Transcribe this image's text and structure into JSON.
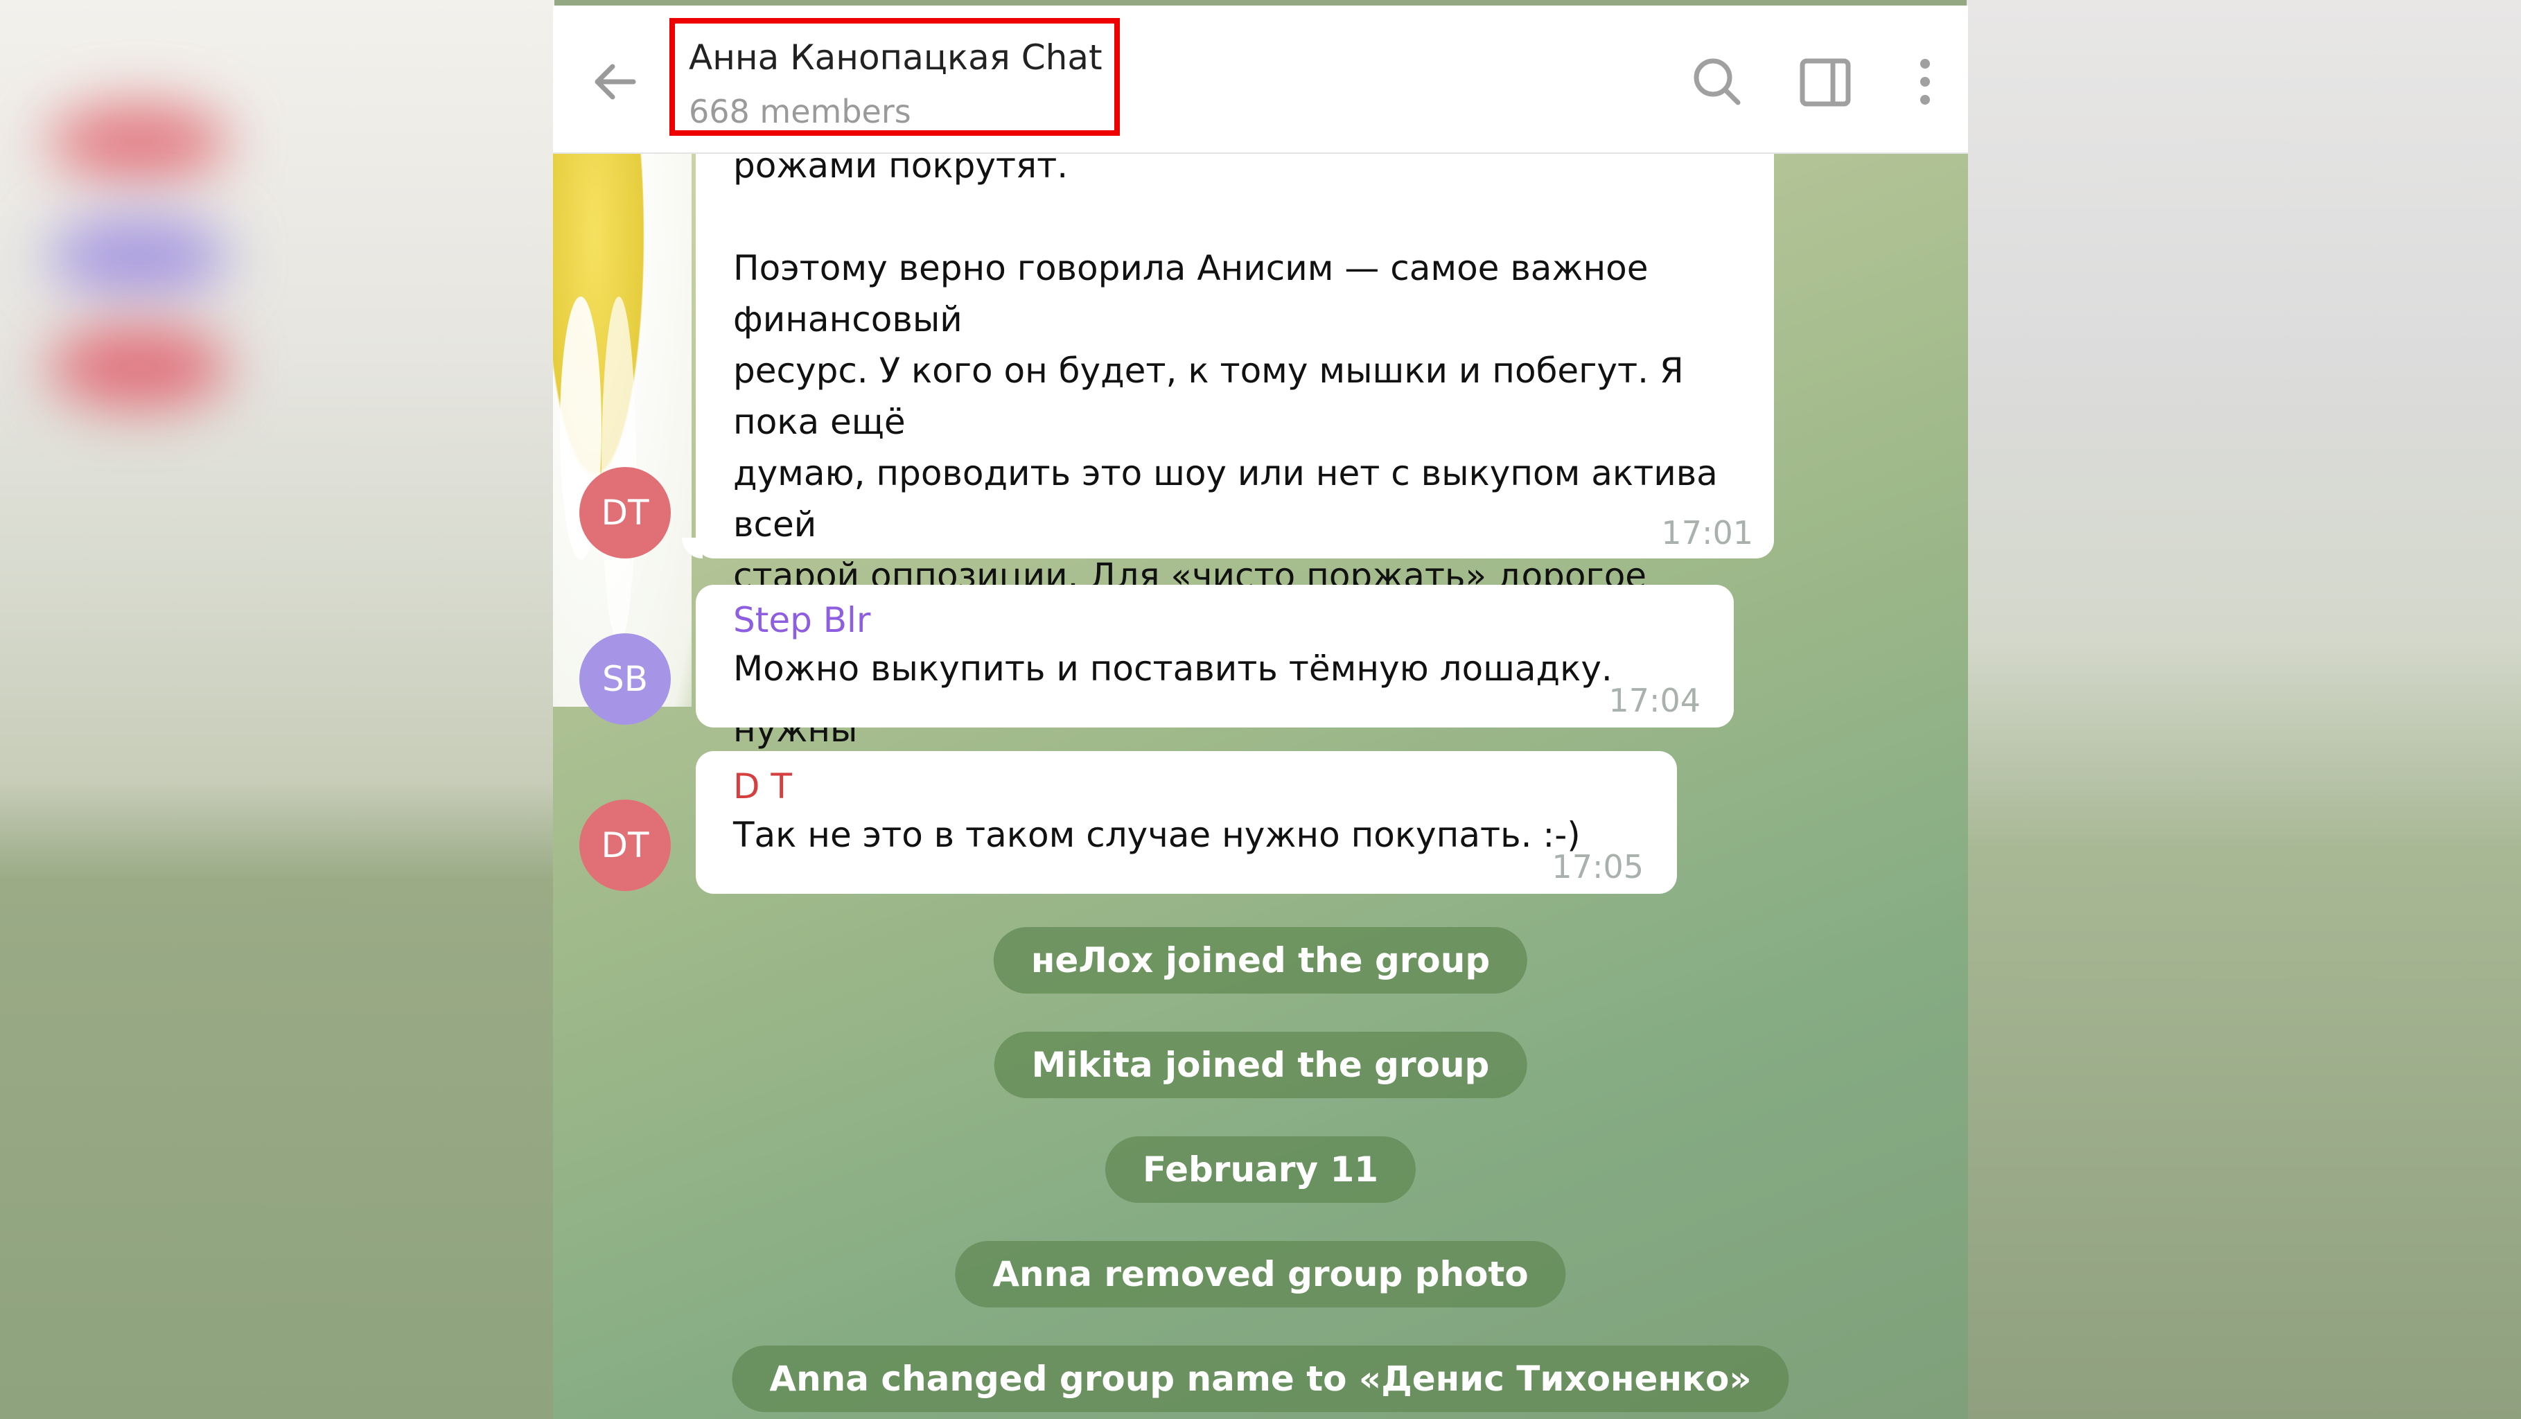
{
  "chat": {
    "title": "Анна Канопацкая Chat",
    "members": "668 members",
    "highlight_color": "#ee0000"
  },
  "header_icons": [
    "back-arrow-icon",
    "search-icon",
    "sidebar-toggle-icon",
    "more-vertical-icon"
  ],
  "messages": [
    {
      "avatar": "DT",
      "avatar_color": "#e17076",
      "sender": "",
      "text": "рожами покрутят.\n\nПоэтому верно говорила Анисим — самое важное финансовый\nресурс. У кого он будет, к тому мышки и побегут. Я пока ещё\nдумаю, проводить это шоу или нет с выкупом актива всей\nстарой оппозиции. Для «чисто поржать» дорогое удовольствие.\nА для других целей эти маргиналы вроде как и не нужны\nбольше.",
      "time": "17:01"
    },
    {
      "avatar": "SB",
      "avatar_color": "#a695e7",
      "sender": "Step Blr",
      "sender_color": "#8e5ee0",
      "text": "Можно выкупить и поставить тёмную лошадку.",
      "time": "17:04"
    },
    {
      "avatar": "DT",
      "avatar_color": "#e17076",
      "sender": "D T",
      "sender_color": "#d63f3f",
      "text": "Так не это в таком случае нужно покупать. :-)",
      "time": "17:05"
    }
  ],
  "service_messages": [
    "неЛох joined the group",
    "Mikita joined the group",
    "February 11",
    "Anna removed group photo",
    "Anna changed group name to «Денис Тихоненко»"
  ]
}
